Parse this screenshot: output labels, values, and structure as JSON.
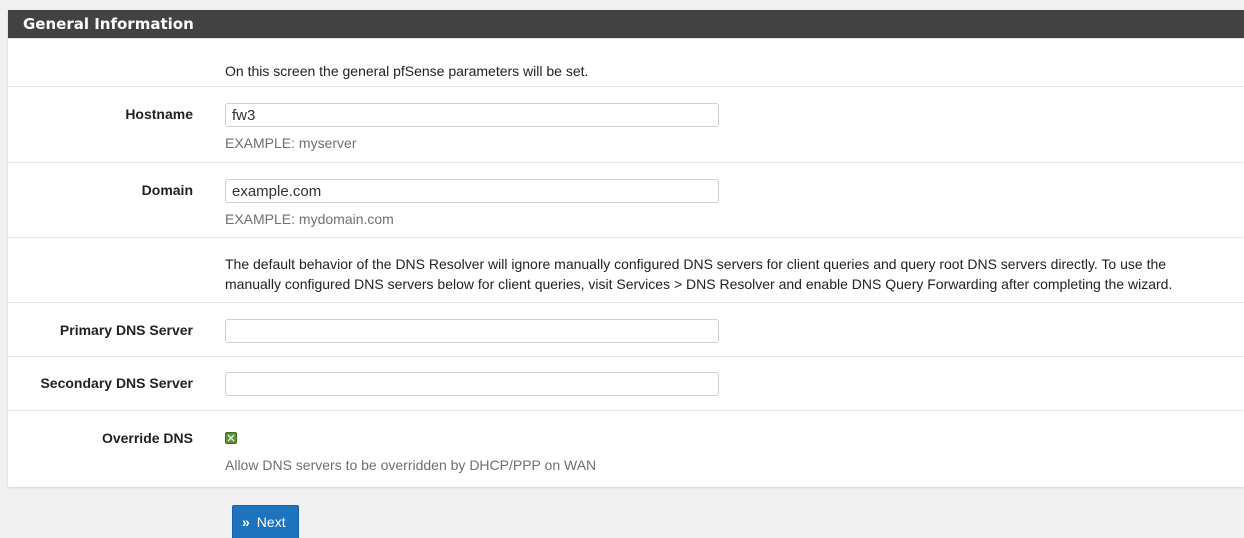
{
  "panel": {
    "title": "General Information"
  },
  "intro": {
    "text": "On this screen the general pfSense parameters will be set."
  },
  "hostname": {
    "label": "Hostname",
    "value": "fw3",
    "help": "EXAMPLE: myserver"
  },
  "domain": {
    "label": "Domain",
    "value": "example.com",
    "help": "EXAMPLE: mydomain.com"
  },
  "dns_note": {
    "line1": "The default behavior of the DNS Resolver will ignore manually configured DNS servers for client queries and query root DNS servers directly. To use the",
    "line2": "manually configured DNS servers below for client queries, visit Services > DNS Resolver and enable DNS Query Forwarding after completing the wizard."
  },
  "primary_dns": {
    "label": "Primary DNS Server",
    "value": ""
  },
  "secondary_dns": {
    "label": "Secondary DNS Server",
    "value": ""
  },
  "override_dns": {
    "label": "Override DNS",
    "checked": true,
    "help": "Allow DNS servers to be overridden by DHCP/PPP on WAN"
  },
  "actions": {
    "next_label": "Next",
    "next_icon": "double-chevron-right-icon"
  },
  "colors": {
    "heading_bg": "#424242",
    "button_bg": "#1e73be",
    "checkbox": "#5c8f3a"
  }
}
